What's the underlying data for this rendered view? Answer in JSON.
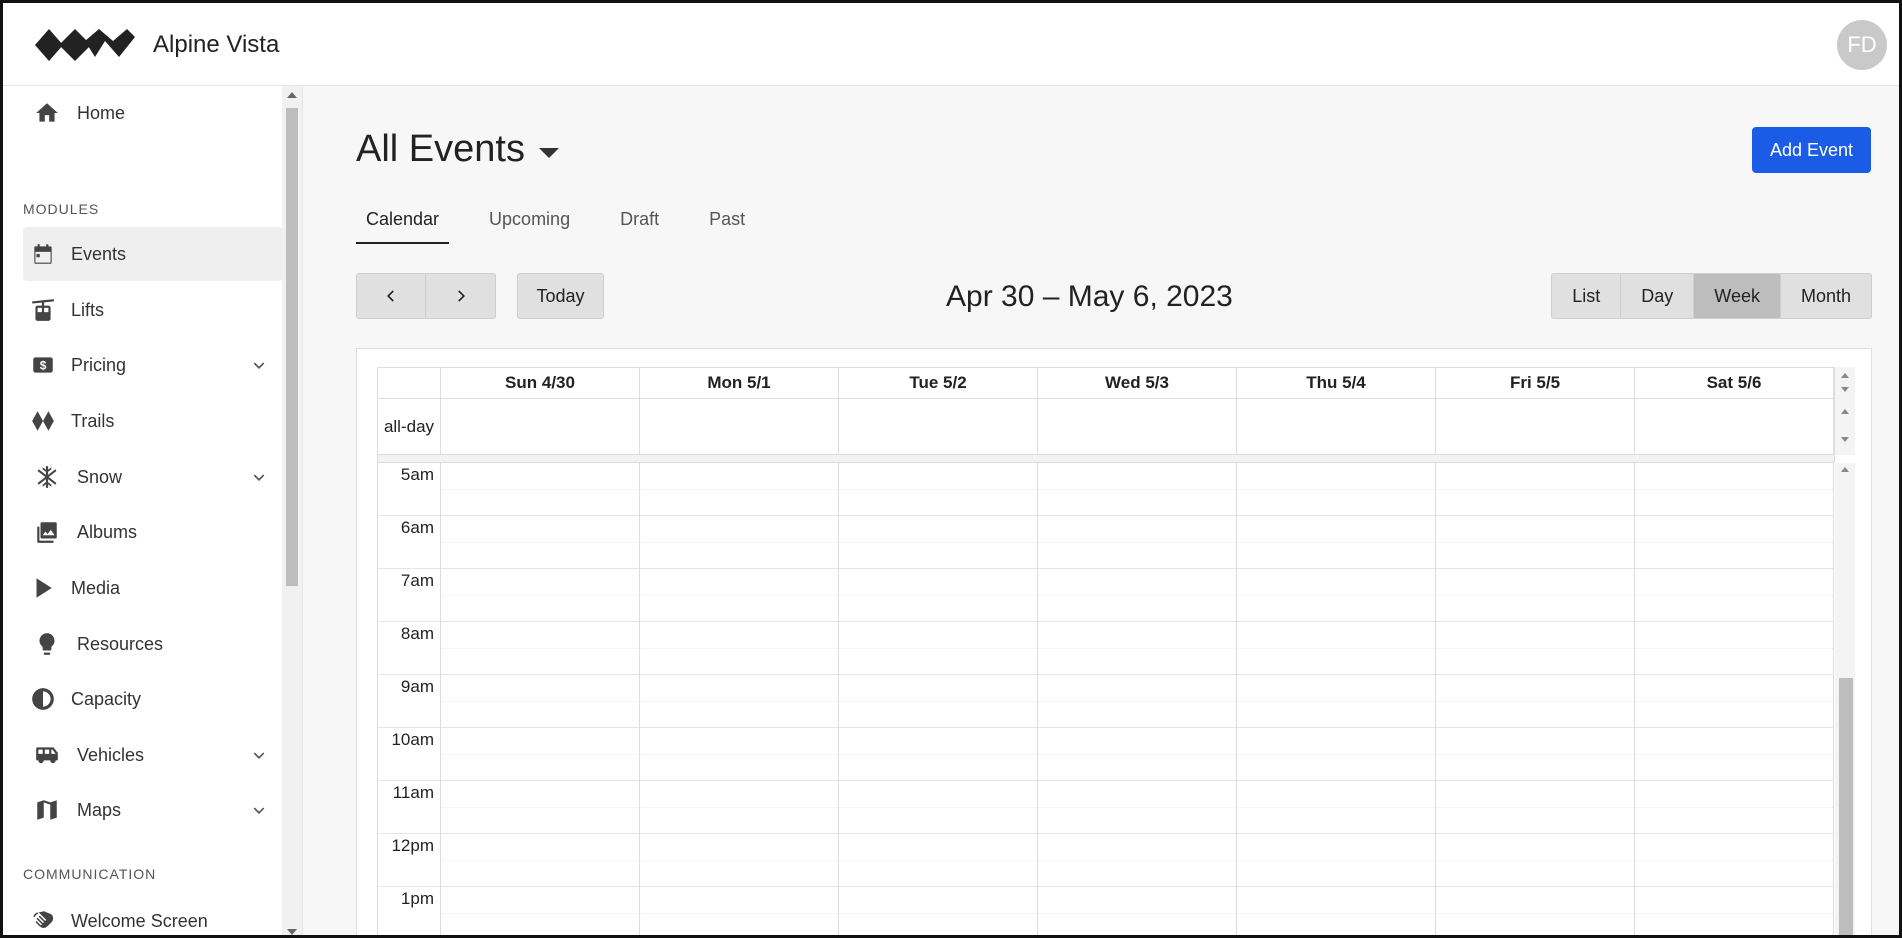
{
  "app": {
    "title": "Alpine Vista",
    "avatar_initials": "FD"
  },
  "sidebar": {
    "items": [
      {
        "label": "Home",
        "icon": "home-icon"
      },
      {
        "label": "Events",
        "icon": "calendar-icon",
        "active": true
      },
      {
        "label": "Lifts",
        "icon": "gondola-icon"
      },
      {
        "label": "Pricing",
        "icon": "dollar-icon",
        "expandable": true
      },
      {
        "label": "Trails",
        "icon": "diamond-icon"
      },
      {
        "label": "Snow",
        "icon": "snowflake-icon",
        "expandable": true
      },
      {
        "label": "Albums",
        "icon": "photo-album-icon"
      },
      {
        "label": "Media",
        "icon": "play-icon"
      },
      {
        "label": "Resources",
        "icon": "lightbulb-icon"
      },
      {
        "label": "Capacity",
        "icon": "gauge-icon"
      },
      {
        "label": "Vehicles",
        "icon": "bus-icon",
        "expandable": true
      },
      {
        "label": "Maps",
        "icon": "map-icon",
        "expandable": true
      },
      {
        "label": "Welcome Screen",
        "icon": "wave-hand-icon"
      }
    ],
    "sections": {
      "modules": "MODULES",
      "communication": "COMMUNICATION"
    }
  },
  "main": {
    "title": "All Events",
    "add_button": "Add Event",
    "tabs": [
      {
        "label": "Calendar",
        "active": true
      },
      {
        "label": "Upcoming"
      },
      {
        "label": "Draft"
      },
      {
        "label": "Past"
      }
    ],
    "toolbar": {
      "today": "Today",
      "date_range": "Apr 30 – May 6, 2023",
      "views": [
        {
          "label": "List"
        },
        {
          "label": "Day"
        },
        {
          "label": "Week",
          "active": true
        },
        {
          "label": "Month"
        }
      ]
    },
    "calendar": {
      "days": [
        "Sun 4/30",
        "Mon 5/1",
        "Tue 5/2",
        "Wed 5/3",
        "Thu 5/4",
        "Fri 5/5",
        "Sat 5/6"
      ],
      "allday_label": "all-day",
      "hours": [
        "5am",
        "6am",
        "7am",
        "8am",
        "9am",
        "10am",
        "11am",
        "12pm",
        "1pm"
      ]
    }
  },
  "colors": {
    "accent": "#1a5ce6",
    "active_view": "#bdbdbd"
  }
}
